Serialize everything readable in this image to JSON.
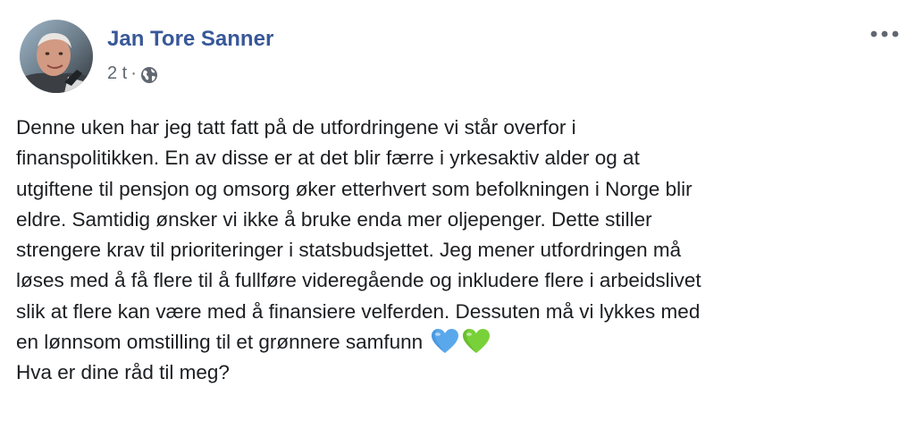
{
  "post": {
    "author_name": "Jan Tore Sanner",
    "timestamp": "2 t",
    "separator": "·",
    "privacy_icon": "globe-icon",
    "more_icon": "more-options-icon",
    "text_lines": [
      "Denne uken har jeg tatt fatt på de utfordringene vi står overfor i",
      "finanspolitikken. En av disse er at det blir færre i yrkesaktiv alder og at",
      "utgiftene til pensjon og omsorg øker etterhvert som befolkningen i Norge blir",
      "eldre. Samtidig ønsker vi ikke å bruke enda mer oljepenger. Dette stiller",
      "strengere krav til prioriteringer i statsbudsjettet. Jeg mener utfordringen må",
      "løses med å få flere til å fullføre videregående og inkludere flere i arbeidslivet",
      "slik at flere kan være med å finansiere velferden. Dessuten må vi lykkes med",
      "en lønnsom omstilling til et grønnere samfunn",
      "Hva er dine råd til meg?"
    ],
    "emojis": [
      "blue-heart-icon",
      "green-heart-icon"
    ],
    "colors": {
      "author_link": "#385898",
      "meta_text": "#606770",
      "body_text": "#1c1e21",
      "blue_heart": "#5aa8ec",
      "green_heart": "#79d13a"
    }
  }
}
